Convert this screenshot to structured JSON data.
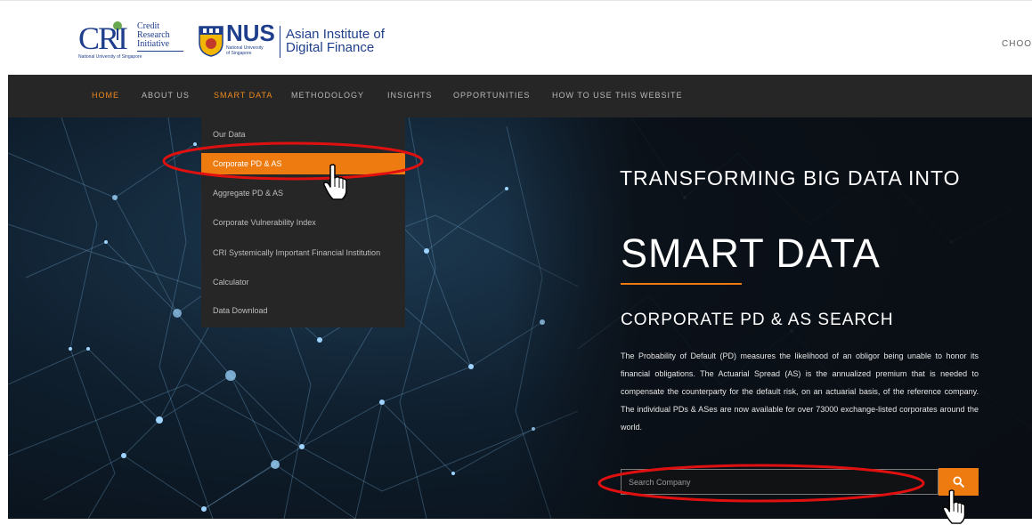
{
  "header": {
    "cri_mark": "CRI",
    "cri_lines": [
      "Credit",
      "Research",
      "Initiative"
    ],
    "cri_sub": "National University of Singapore",
    "nus_word": "NUS",
    "nus_small": [
      "National University",
      "of Singapore"
    ],
    "aidf_lines": [
      "Asian Institute of",
      "Digital Finance"
    ],
    "choose_label": "CHOO"
  },
  "nav": {
    "items": [
      "HOME",
      "ABOUT US",
      "SMART DATA",
      "METHODOLOGY",
      "INSIGHTS",
      "OPPORTUNITIES",
      "HOW TO USE THIS WEBSITE"
    ],
    "active_item": "HOME",
    "open_menu": "SMART DATA"
  },
  "dropdown": {
    "items": [
      "Our Data",
      "Corporate PD & AS",
      "Aggregate PD & AS",
      "Corporate Vulnerability Index",
      "CRI Systemically Important Financial Institution",
      "Calculator",
      "Data Download"
    ],
    "selected_item": "Corporate PD & AS"
  },
  "hero": {
    "headline1": "TRANSFORMING BIG DATA INTO",
    "headline2": "SMART DATA",
    "section_title": "CORPORATE PD & AS SEARCH",
    "description": "The Probability of Default (PD) measures the likelihood of an obligor being unable to honor its financial obligations. The Actuarial Spread (AS) is the annualized premium that is needed to compensate the counterparty for the default risk, on an actuarial basis, of the reference company. The individual PDs & ASes are now available for over 73000 exchange-listed corporates around the world."
  },
  "search": {
    "placeholder": "Search Company",
    "value": "",
    "button_icon": "search-icon"
  },
  "colors": {
    "accent": "#ee7b10",
    "nav_bg": "#262626",
    "brand_blue": "#1f3f8c",
    "annotation_red": "#e01010"
  }
}
